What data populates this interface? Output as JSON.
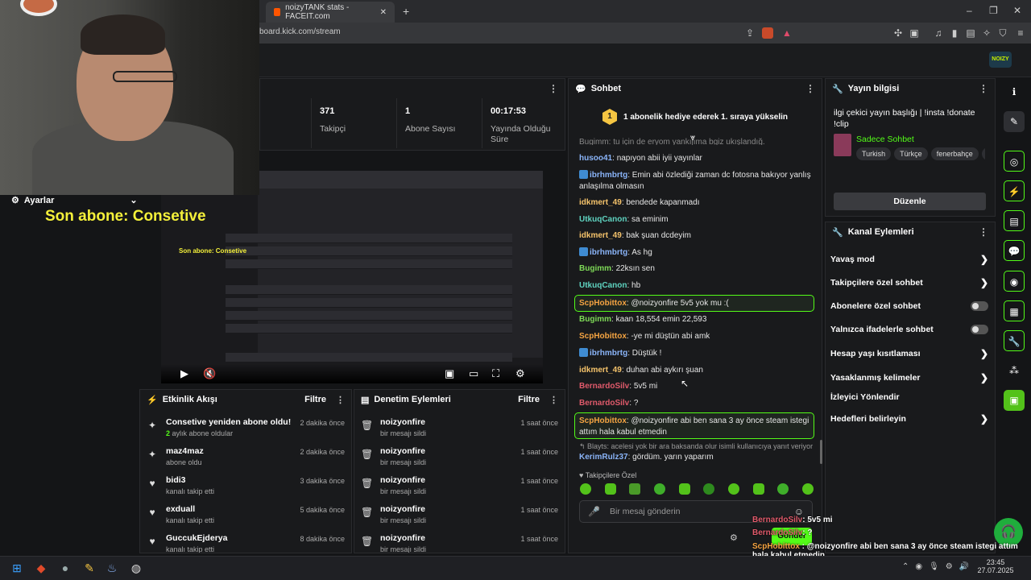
{
  "browser": {
    "tab_title": "noizyTANK stats - FACEIT.com",
    "new_tab": "+",
    "url": "board.kick.com/stream",
    "window_controls": [
      "–",
      "❐",
      "✕"
    ]
  },
  "header": {
    "logo_text": "NOIZY"
  },
  "stats": [
    {
      "value": "371",
      "label": "Takipçi"
    },
    {
      "value": "1",
      "label": "Abone Sayısı"
    },
    {
      "value": "00:17:53",
      "label": "Yayında Olduğu Süre"
    }
  ],
  "overlay": {
    "settings_label": "Ayarlar",
    "last_sub": "Son abone: Consetive",
    "preview_last_sub": "Son abone: Consetive"
  },
  "activity": {
    "title": "Etkinlik Akışı",
    "filter": "Filtre",
    "items": [
      {
        "icon": "sparkle-icon",
        "name": "Consetive yeniden abone oldu!",
        "sub_num": "2",
        "sub": " aylık abone oldular",
        "time": "2 dakika önce"
      },
      {
        "icon": "sparkle-icon",
        "name": "maz4maz",
        "sub": "abone oldu",
        "time": "2 dakika önce"
      },
      {
        "icon": "heart-icon",
        "name": "bidi3",
        "sub": "kanalı takip etti",
        "time": "3 dakika önce"
      },
      {
        "icon": "heart-icon",
        "name": "exduall",
        "sub": "kanalı takip etti",
        "time": "5 dakika önce"
      },
      {
        "icon": "heart-icon",
        "name": "GuccukEjderya",
        "sub": "kanalı takip etti",
        "time": "8 dakika önce"
      }
    ]
  },
  "moderation": {
    "title": "Denetim Eylemleri",
    "filter": "Filtre",
    "items": [
      {
        "name": "noizyonfire",
        "sub": "bir mesajı sildi",
        "time": "1 saat önce"
      },
      {
        "name": "noizyonfire",
        "sub": "bir mesajı sildi",
        "time": "1 saat önce"
      },
      {
        "name": "noizyonfire",
        "sub": "bir mesajı sildi",
        "time": "1 saat önce"
      },
      {
        "name": "noizyonfire",
        "sub": "bir mesajı sildi",
        "time": "1 saat önce"
      },
      {
        "name": "noizyonfire",
        "sub": "bir mesajı sildi",
        "time": "1 saat önce"
      }
    ]
  },
  "chat": {
    "title": "Sohbet",
    "gift_badge": "1",
    "gift_text": "1 abonelik hediye ederek 1. sıraya yükselin",
    "cut_line": "Bugimm: tu için de eryom yankıjıma bgiz ukışlandığ.",
    "messages": [
      {
        "user": "husoo41",
        "color": "#8ab4f8",
        "text": "napıyon abii iyii yayınlar"
      },
      {
        "user": "ibrhmbrtg",
        "color": "#8ab4f8",
        "badge": true,
        "text": "Emin abi özlediği zaman dc fotosna bakıyor yanlış anlaşılma olmasın"
      },
      {
        "user": "idkmert_49",
        "color": "#f5c36b",
        "text": "bendede kapanmadı"
      },
      {
        "user": "UtkuqCanon",
        "color": "#5fd3c0",
        "text": "sa eminim"
      },
      {
        "user": "idkmert_49",
        "color": "#f5c36b",
        "text": "bak şuan dcdeyim"
      },
      {
        "user": "ibrhmbrtg",
        "color": "#8ab4f8",
        "badge": true,
        "text": "As hg"
      },
      {
        "user": "Bugimm",
        "color": "#7ed957",
        "text": "22ksın sen"
      },
      {
        "user": "UtkuqCanon",
        "color": "#5fd3c0",
        "text": "hb"
      },
      {
        "user": "ScpHobittox",
        "color": "#f5a442",
        "text": "@noizyonfire 5v5 yok mu :(",
        "highlight": true
      },
      {
        "user": "Bugimm",
        "color": "#7ed957",
        "text": "kaan 18,554 emin 22,593"
      },
      {
        "user": "ScpHobittox",
        "color": "#f5a442",
        "text": "-ye mi düştün abi amk"
      },
      {
        "user": "ibrhmbrtg",
        "color": "#8ab4f8",
        "badge": true,
        "text": "Düştük !"
      },
      {
        "user": "idkmert_49",
        "color": "#f5c36b",
        "text": "duhan abi aykırı şuan"
      },
      {
        "user": "BernardoSilv",
        "color": "#e05a6b",
        "text": "5v5 mi"
      },
      {
        "user": "BernardoSilv",
        "color": "#e05a6b",
        "text": "?"
      },
      {
        "user": "ScpHobittox",
        "color": "#f5a442",
        "text": "@noizyonfire abi ben sana 3 ay önce steam istegi attım hala kabul etmedin",
        "highlight": true
      },
      {
        "user": "KerimRulz37",
        "color": "#8ab4f8",
        "text": "gördüm. yarın yaparım"
      }
    ],
    "reply_note": "Blayts: acelesi yok bir ara baksanda olur isimli kullanıcıya yanıt veriyor",
    "followers_only": "Takipçilere Özel",
    "input_placeholder": "Bir mesaj gönderin",
    "send_label": "Gönder"
  },
  "stream_info": {
    "title": "Yayın bilgisi",
    "stream_title": "ilgi çekici yayın başlığı | !insta !donate !clip",
    "category": "Sadece Sohbet",
    "tags": [
      "Turkish",
      "Türkçe",
      "fenerbahçe",
      "M"
    ],
    "edit_label": "Düzenle"
  },
  "channel_actions": {
    "title": "Kanal Eylemleri",
    "items": [
      {
        "label": "Yavaş mod",
        "control": "chevron"
      },
      {
        "label": "Takipçilere özel sohbet",
        "control": "chevron"
      },
      {
        "label": "Abonelere özel sohbet",
        "control": "toggle"
      },
      {
        "label": "Yalnızca ifadelerle sohbet",
        "control": "toggle"
      },
      {
        "label": "Hesap yaşı kısıtlaması",
        "control": "chevron"
      },
      {
        "label": "Yasaklanmış kelimeler",
        "control": "chevron"
      },
      {
        "label": "İzleyici Yönlendir",
        "control": "none"
      },
      {
        "label": "Hedefleri belirleyin",
        "control": "chevron"
      }
    ]
  },
  "overlay_chat": [
    {
      "user": "BernardoSilv",
      "color": "#e05a6b",
      "text": ": 5v5 mi"
    },
    {
      "user": "BernardoSilv",
      "color": "#e05a6b",
      "text": ": ?"
    },
    {
      "user": "ScpHobittox",
      "color": "#f5a442",
      "text": " : @noizyonfire abi ben sana 3 ay önce steam istegi attım hala kabul etmedin"
    },
    {
      "user": "KerimRulz37",
      "color": "#8ab4f8",
      "text": " : gördüm. yarın yaparım"
    }
  ],
  "taskbar": {
    "time": "23:45",
    "date": "27.07.2025"
  },
  "colors": {
    "accent": "#53fc18",
    "gift": "#f5c542"
  }
}
